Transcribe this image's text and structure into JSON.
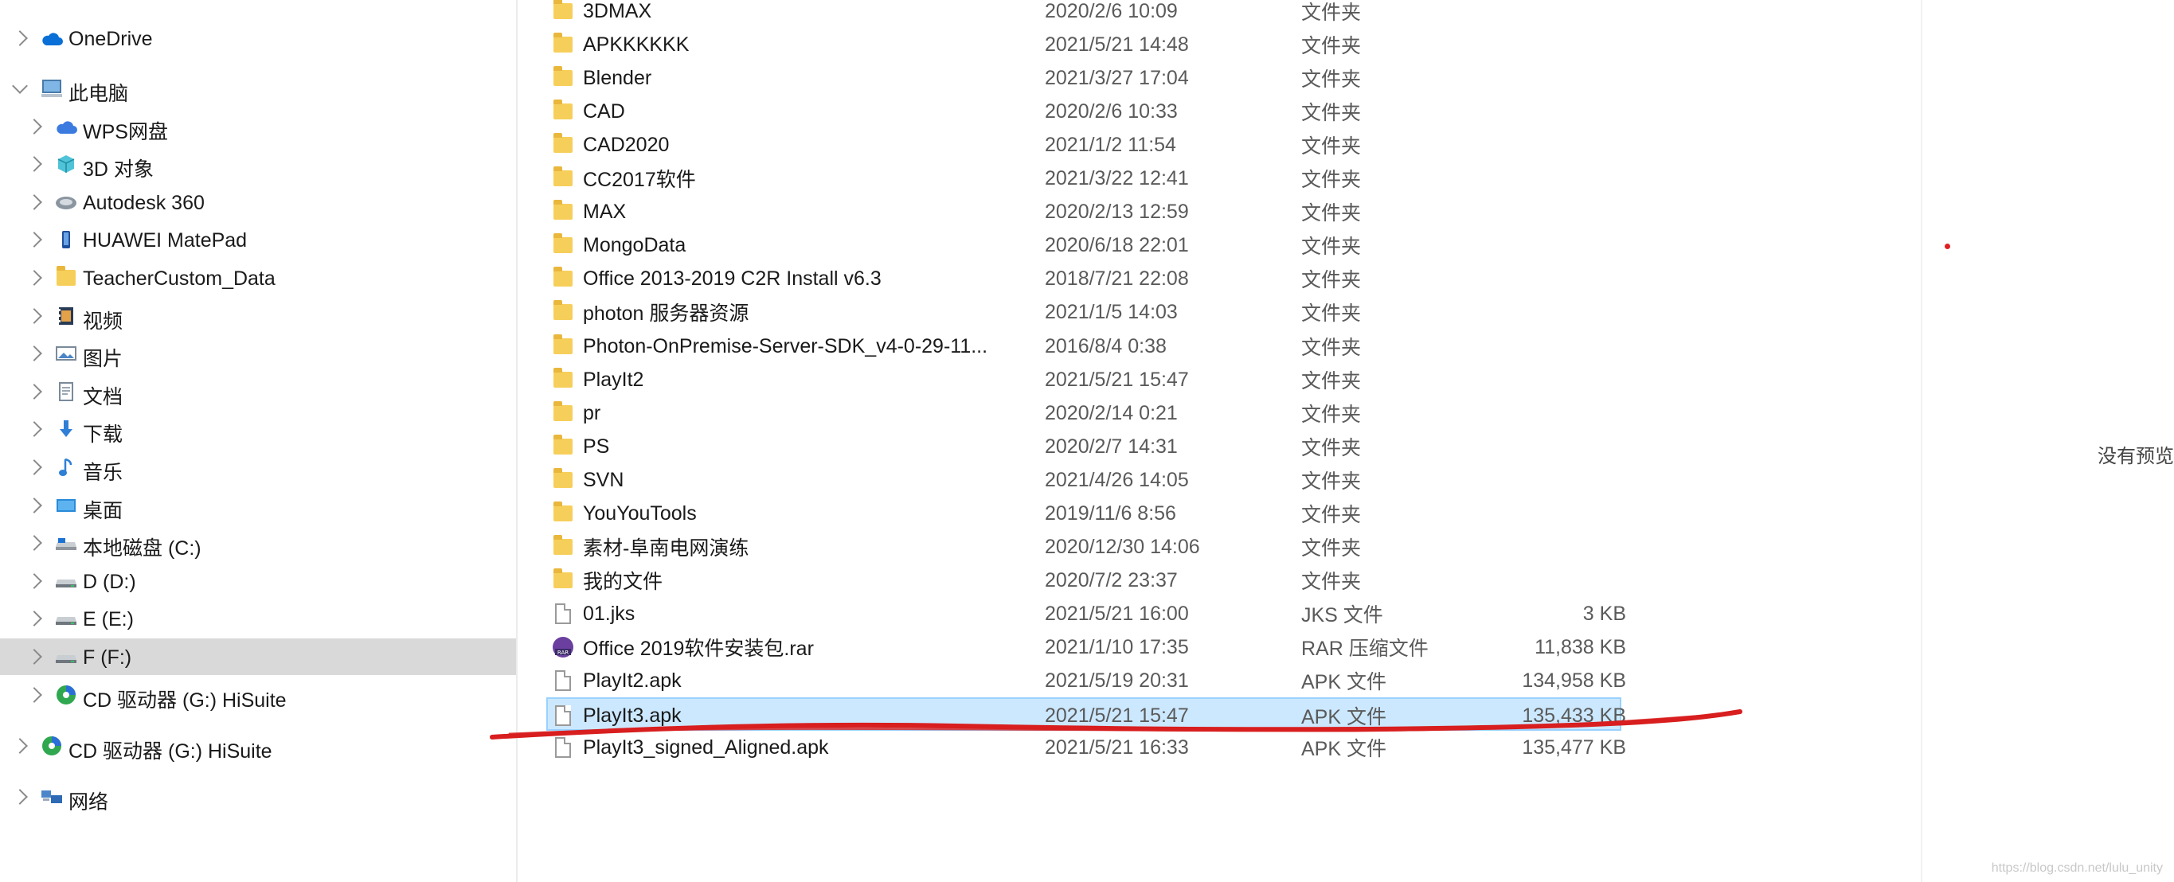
{
  "nav": {
    "items": [
      {
        "label": "OneDrive",
        "icon": "onedrive-cloud-icon",
        "expanded": false,
        "level": 0
      },
      {
        "label": "此电脑",
        "icon": "this-pc-icon",
        "expanded": true,
        "level": 0
      },
      {
        "label": "WPS网盘",
        "icon": "wps-cloud-icon",
        "expanded": false,
        "level": 1
      },
      {
        "label": "3D 对象",
        "icon": "3d-objects-icon",
        "expanded": false,
        "level": 1
      },
      {
        "label": "Autodesk 360",
        "icon": "autodesk-360-icon",
        "expanded": false,
        "level": 1
      },
      {
        "label": "HUAWEI MatePad",
        "icon": "tablet-device-icon",
        "expanded": false,
        "level": 1
      },
      {
        "label": "TeacherCustom_Data",
        "icon": "folder-icon",
        "expanded": false,
        "level": 1
      },
      {
        "label": "视频",
        "icon": "videos-icon",
        "expanded": false,
        "level": 1
      },
      {
        "label": "图片",
        "icon": "pictures-icon",
        "expanded": false,
        "level": 1
      },
      {
        "label": "文档",
        "icon": "documents-icon",
        "expanded": false,
        "level": 1
      },
      {
        "label": "下载",
        "icon": "downloads-icon",
        "expanded": false,
        "level": 1
      },
      {
        "label": "音乐",
        "icon": "music-icon",
        "expanded": false,
        "level": 1
      },
      {
        "label": "桌面",
        "icon": "desktop-icon",
        "expanded": false,
        "level": 1
      },
      {
        "label": "本地磁盘 (C:)",
        "icon": "local-disk-icon",
        "expanded": false,
        "level": 1
      },
      {
        "label": "D (D:)",
        "icon": "drive-icon",
        "expanded": false,
        "level": 1
      },
      {
        "label": "E (E:)",
        "icon": "drive-icon",
        "expanded": false,
        "level": 1
      },
      {
        "label": "F (F:)",
        "icon": "drive-icon",
        "expanded": false,
        "level": 1,
        "selected": true
      },
      {
        "label": "CD 驱动器 (G:) HiSuite",
        "icon": "cd-drive-icon",
        "expanded": false,
        "level": 1
      },
      {
        "label": "CD 驱动器 (G:) HiSuite",
        "icon": "cd-drive-icon",
        "expanded": false,
        "level": 0
      },
      {
        "label": "网络",
        "icon": "network-icon",
        "expanded": false,
        "level": 0
      }
    ]
  },
  "files": [
    {
      "name": "3DMAX",
      "date": "2020/2/6 10:09",
      "type": "文件夹",
      "size": "",
      "icon": "folder-icon"
    },
    {
      "name": "APKKKKKK",
      "date": "2021/5/21 14:48",
      "type": "文件夹",
      "size": "",
      "icon": "folder-icon"
    },
    {
      "name": "Blender",
      "date": "2021/3/27 17:04",
      "type": "文件夹",
      "size": "",
      "icon": "folder-icon"
    },
    {
      "name": "CAD",
      "date": "2020/2/6 10:33",
      "type": "文件夹",
      "size": "",
      "icon": "folder-icon"
    },
    {
      "name": "CAD2020",
      "date": "2021/1/2 11:54",
      "type": "文件夹",
      "size": "",
      "icon": "folder-icon"
    },
    {
      "name": "CC2017软件",
      "date": "2021/3/22 12:41",
      "type": "文件夹",
      "size": "",
      "icon": "folder-icon"
    },
    {
      "name": "MAX",
      "date": "2020/2/13 12:59",
      "type": "文件夹",
      "size": "",
      "icon": "folder-icon"
    },
    {
      "name": "MongoData",
      "date": "2020/6/18 22:01",
      "type": "文件夹",
      "size": "",
      "icon": "folder-icon"
    },
    {
      "name": "Office 2013-2019 C2R Install v6.3",
      "date": "2018/7/21 22:08",
      "type": "文件夹",
      "size": "",
      "icon": "folder-icon"
    },
    {
      "name": "photon 服务器资源",
      "date": "2021/1/5 14:03",
      "type": "文件夹",
      "size": "",
      "icon": "folder-icon"
    },
    {
      "name": "Photon-OnPremise-Server-SDK_v4-0-29-11...",
      "date": "2016/8/4 0:38",
      "type": "文件夹",
      "size": "",
      "icon": "folder-icon"
    },
    {
      "name": "PlayIt2",
      "date": "2021/5/21 15:47",
      "type": "文件夹",
      "size": "",
      "icon": "folder-icon"
    },
    {
      "name": "pr",
      "date": "2020/2/14 0:21",
      "type": "文件夹",
      "size": "",
      "icon": "folder-icon"
    },
    {
      "name": "PS",
      "date": "2020/2/7 14:31",
      "type": "文件夹",
      "size": "",
      "icon": "folder-icon"
    },
    {
      "name": "SVN",
      "date": "2021/4/26 14:05",
      "type": "文件夹",
      "size": "",
      "icon": "folder-icon"
    },
    {
      "name": "YouYouTools",
      "date": "2019/11/6 8:56",
      "type": "文件夹",
      "size": "",
      "icon": "folder-icon"
    },
    {
      "name": "素材-阜南电网演练",
      "date": "2020/12/30 14:06",
      "type": "文件夹",
      "size": "",
      "icon": "folder-icon"
    },
    {
      "name": "我的文件",
      "date": "2020/7/2 23:37",
      "type": "文件夹",
      "size": "",
      "icon": "folder-icon"
    },
    {
      "name": "01.jks",
      "date": "2021/5/21 16:00",
      "type": "JKS 文件",
      "size": "3 KB",
      "icon": "file-icon"
    },
    {
      "name": "Office 2019软件安装包.rar",
      "date": "2021/1/10 17:35",
      "type": "RAR 压缩文件",
      "size": "11,838 KB",
      "icon": "rar-archive-icon"
    },
    {
      "name": "PlayIt2.apk",
      "date": "2021/5/19 20:31",
      "type": "APK 文件",
      "size": "134,958 KB",
      "icon": "file-icon"
    },
    {
      "name": "PlayIt3.apk",
      "date": "2021/5/21 15:47",
      "type": "APK 文件",
      "size": "135,433 KB",
      "icon": "file-icon",
      "selected": true
    },
    {
      "name": "PlayIt3_signed_Aligned.apk",
      "date": "2021/5/21 16:33",
      "type": "APK 文件",
      "size": "135,477 KB",
      "icon": "file-icon"
    }
  ],
  "preview": {
    "empty_text": "没有预览"
  },
  "watermark": "https://blog.csdn.net/lulu_unity",
  "colors": {
    "selection": "#cce8ff",
    "selection_border": "#99d1ff",
    "nav_selected": "#d9d9d9",
    "annotation": "#d81e1e",
    "folder": "#f6cf5b"
  }
}
